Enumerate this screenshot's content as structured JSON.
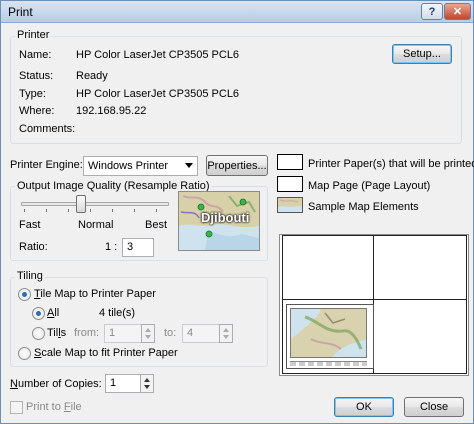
{
  "window": {
    "title": "Print",
    "help_label": "?",
    "close_label": "✕"
  },
  "printer": {
    "group_label": "Printer",
    "name_label": "Name:",
    "name_value": "HP Color LaserJet CP3505 PCL6",
    "status_label": "Status:",
    "status_value": "Ready",
    "type_label": "Type:",
    "type_value": "HP Color LaserJet CP3505 PCL6",
    "where_label": "Where:",
    "where_value": "192.168.95.22",
    "comments_label": "Comments:",
    "comments_value": "",
    "setup_label": "Setup..."
  },
  "engine": {
    "label": "Printer Engine:",
    "selected": "Windows Printer",
    "properties_label": "Properties..."
  },
  "quality": {
    "group_label": "Output Image Quality (Resample Ratio)",
    "fast_label": "Fast",
    "normal_label": "Normal",
    "best_label": "Best",
    "slider_level": 0.4,
    "ratio_label": "Ratio:",
    "ratio_prefix": "1 :",
    "ratio_value": "3",
    "thumbnail_label": "Djibouti"
  },
  "legend": {
    "printer_papers": "Printer Paper(s) that will be printed",
    "map_page": "Map Page (Page Layout)",
    "sample_elements": "Sample Map Elements"
  },
  "tiling": {
    "group_label": "Tiling",
    "tile_label": "Tile Map to Printer Paper",
    "all_label": "All",
    "tiles_count": "4 tile(s)",
    "tiles_label": "Tiles",
    "from_label": "from:",
    "from_value": "1",
    "to_label": "to:",
    "to_value": "4",
    "scale_label": "Scale Map to fit Printer Paper"
  },
  "copies": {
    "label": "Number of Copies:",
    "value": "1"
  },
  "print_to_file_label": "Print to File",
  "ok_label": "OK",
  "close_label": "Close",
  "colors": {
    "accent": "#2d6ab5",
    "title_bar": "#c9d9ee",
    "close_button": "#c4452d",
    "water": "#cfe3ef",
    "land": "#d8d0a8"
  }
}
